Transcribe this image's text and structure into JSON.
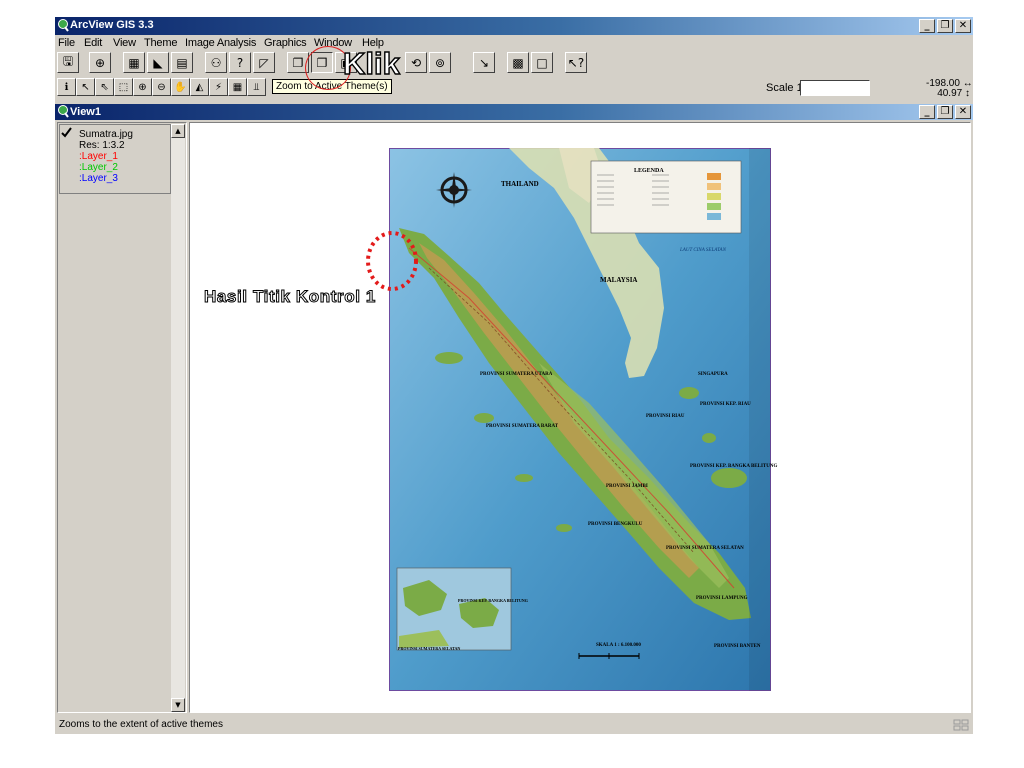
{
  "app": {
    "title": "ArcView GIS 3.3",
    "window_buttons": [
      "_",
      "6",
      "×"
    ]
  },
  "menu": [
    "File",
    "Edit",
    "View",
    "Theme",
    "Image Analysis",
    "Graphics",
    "Window",
    "Help"
  ],
  "tooltip": "Zoom to Active Theme(s)",
  "annotation": {
    "klik": "Klik",
    "hasil": "Hasil Titik Kontrol 1"
  },
  "scale": {
    "label": "Scale 1:",
    "value": ""
  },
  "coords": {
    "x": "-198.00",
    "y": "40.97"
  },
  "view": {
    "title": "View1"
  },
  "toc": {
    "theme": "Sumatra.jpg",
    "res": "Res: 1:3.2",
    "layers": [
      {
        "label": ":Layer_1",
        "color": "#ff0000"
      },
      {
        "label": ":Layer_2",
        "color": "#00c800"
      },
      {
        "label": ":Layer_3",
        "color": "#0000ff"
      }
    ]
  },
  "map": {
    "legend_title": "LEGENDA",
    "countries": [
      "THAILAND",
      "MALAYSIA",
      "SINGAPURA"
    ],
    "sea_label": "LAUT CINA SELATAN",
    "provinces": [
      "PROVINSI SUMATERA UTARA",
      "PROVINSI RIAU",
      "PROVINSI JAMBI",
      "PROVINSI SUMATERA BARAT",
      "PROVINSI SUMATERA SELATAN",
      "PROVINSI BENGKULU",
      "PROVINSI KEP. RIAU",
      "PROVINSI KEP. BANGKA BELITUNG",
      "PROVINSI LAMPUNG",
      "PROVINSI BANTEN"
    ],
    "inset_labels": [
      "PROVINSI KEP. BANGKA BELITUNG",
      "PROVINSI SUMATERA SELATAN"
    ],
    "scale_bar": "SKALA 1 : 6.100.000"
  },
  "status": "Zooms to the extent of active themes",
  "colors": {
    "title_dark": "#0a246a",
    "title_light": "#a6caf0",
    "face": "#d4d0c8",
    "sea": "#5aa2cf",
    "land": "#7bab47",
    "highland": "#c79a52"
  }
}
